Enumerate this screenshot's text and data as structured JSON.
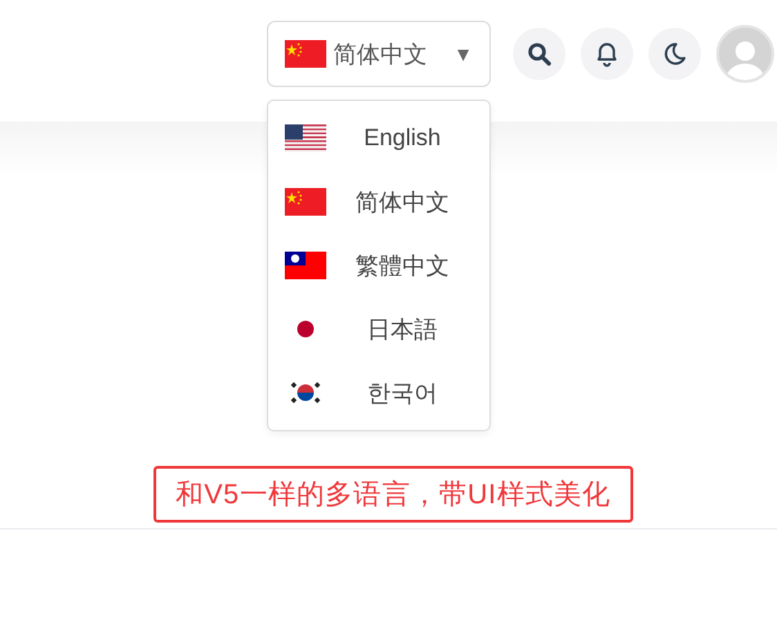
{
  "header": {
    "language_button": {
      "kind": "cn",
      "label": "简体中文",
      "caret": "▼"
    }
  },
  "language_menu": [
    {
      "kind": "us",
      "label": "English"
    },
    {
      "kind": "cn",
      "label": "简体中文"
    },
    {
      "kind": "tw",
      "label": "繁體中文"
    },
    {
      "kind": "jp",
      "label": "日本語"
    },
    {
      "kind": "kr",
      "label": "한국어"
    }
  ],
  "annotation": "和V5一样的多语言，带UI样式美化"
}
